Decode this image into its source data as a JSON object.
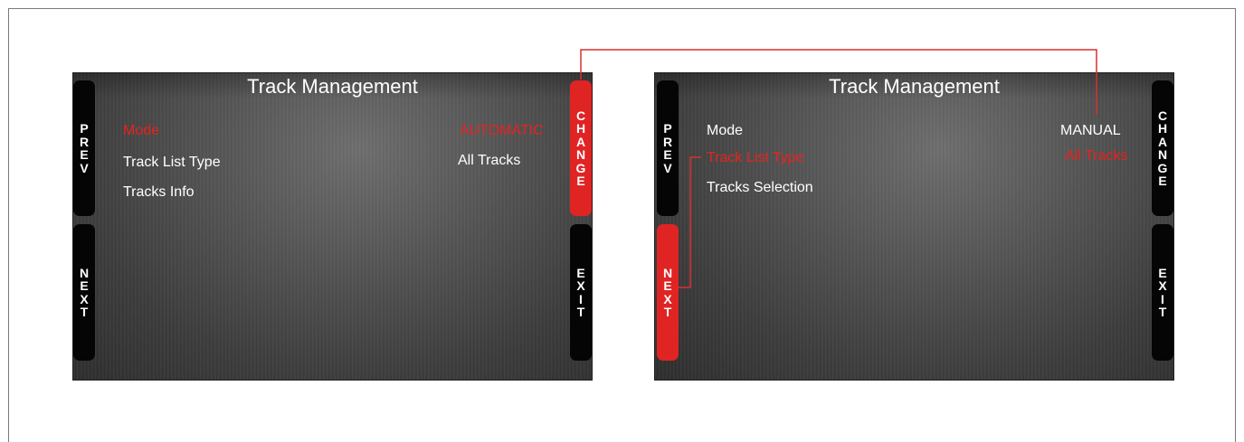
{
  "left_screen": {
    "title": "Track Management",
    "buttons": {
      "prev": "PREV",
      "next": "NEXT",
      "change": "CHANGE",
      "exit": "EXIT"
    },
    "rows": [
      {
        "label": "Mode",
        "value": "AUTOMATIC",
        "highlighted": true
      },
      {
        "label": "Track List Type",
        "value": "All Tracks",
        "highlighted": false
      },
      {
        "label": "Tracks Info",
        "value": "",
        "highlighted": false
      }
    ],
    "active_button": "change"
  },
  "right_screen": {
    "title": "Track Management",
    "buttons": {
      "prev": "PREV",
      "next": "NEXT",
      "change": "CHANGE",
      "exit": "EXIT"
    },
    "rows": [
      {
        "label": "Mode",
        "value": "MANUAL",
        "highlighted": false
      },
      {
        "label": "Track List Type",
        "value": "All Tracks",
        "highlighted": true
      },
      {
        "label": "Tracks Selection",
        "value": "",
        "highlighted": false
      }
    ],
    "active_button": "next"
  },
  "colors": {
    "highlight": "#e8221f",
    "button_active": "#e02424",
    "button_inactive": "#050505",
    "connector": "#d9302c"
  }
}
